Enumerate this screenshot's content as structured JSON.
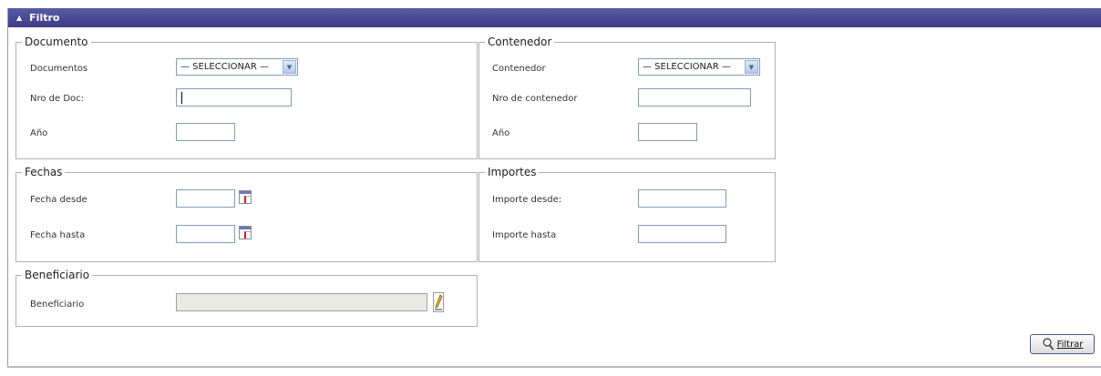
{
  "header": {
    "title": "Filtro",
    "collapse_icon": "triangle-up-icon"
  },
  "documento": {
    "legend": "Documento",
    "documentos_label": "Documentos",
    "documentos_value": "— SELECCIONAR —",
    "nro_label": "Nro de Doc:",
    "nro_value": "",
    "anio_label": "Año",
    "anio_value": ""
  },
  "contenedor": {
    "legend": "Contenedor",
    "contenedor_label": "Contenedor",
    "contenedor_value": "— SELECCIONAR —",
    "nro_label": "Nro de contenedor",
    "nro_value": "",
    "anio_label": "Año",
    "anio_value": ""
  },
  "fechas": {
    "legend": "Fechas",
    "desde_label": "Fecha desde",
    "desde_value": "",
    "hasta_label": "Fecha hasta",
    "hasta_value": ""
  },
  "importes": {
    "legend": "Importes",
    "desde_label": "Importe desde:",
    "desde_value": "",
    "hasta_label": "Importe hasta",
    "hasta_value": ""
  },
  "beneficiario": {
    "legend": "Beneficiario",
    "label": "Beneficiario",
    "value": ""
  },
  "actions": {
    "filter_label": "Filtrar"
  },
  "icons": {
    "calendar": "calendar-icon",
    "edit": "pencil-icon",
    "filter": "funnel-icon"
  },
  "colors": {
    "header_bg": "#46468f",
    "header_text": "#ffffff"
  }
}
